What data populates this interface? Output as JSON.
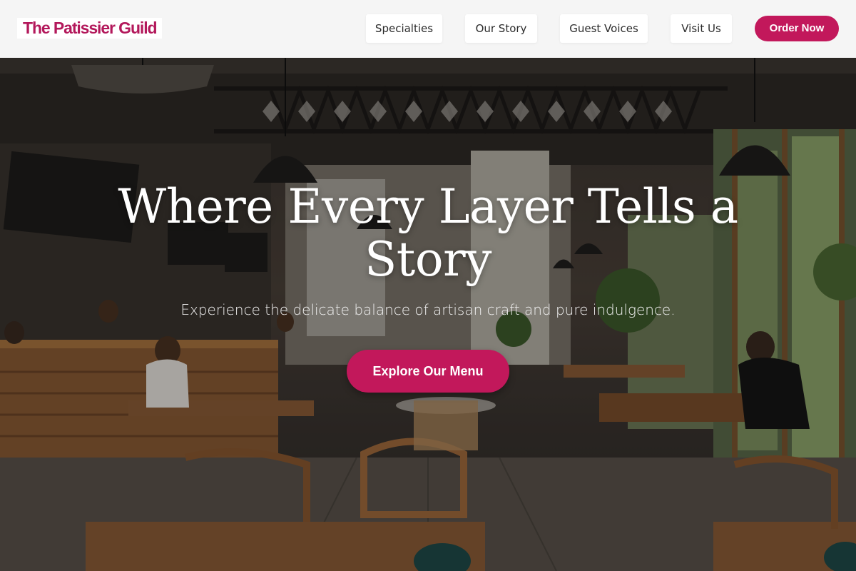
{
  "brand": {
    "name": "The Patissier Guild",
    "accent": "#c2185b"
  },
  "nav": {
    "items": [
      {
        "label": "Specialties"
      },
      {
        "label": "Our Story"
      },
      {
        "label": "Guest Voices"
      },
      {
        "label": "Visit Us"
      }
    ],
    "order_label": "Order Now"
  },
  "hero": {
    "title": "Where Every Layer Tells a Story",
    "subtitle": "Experience the delicate balance of artisan craft and pure indulgence.",
    "cta_label": "Explore Our Menu",
    "background_description_icon": "cafe-interior-photo"
  }
}
